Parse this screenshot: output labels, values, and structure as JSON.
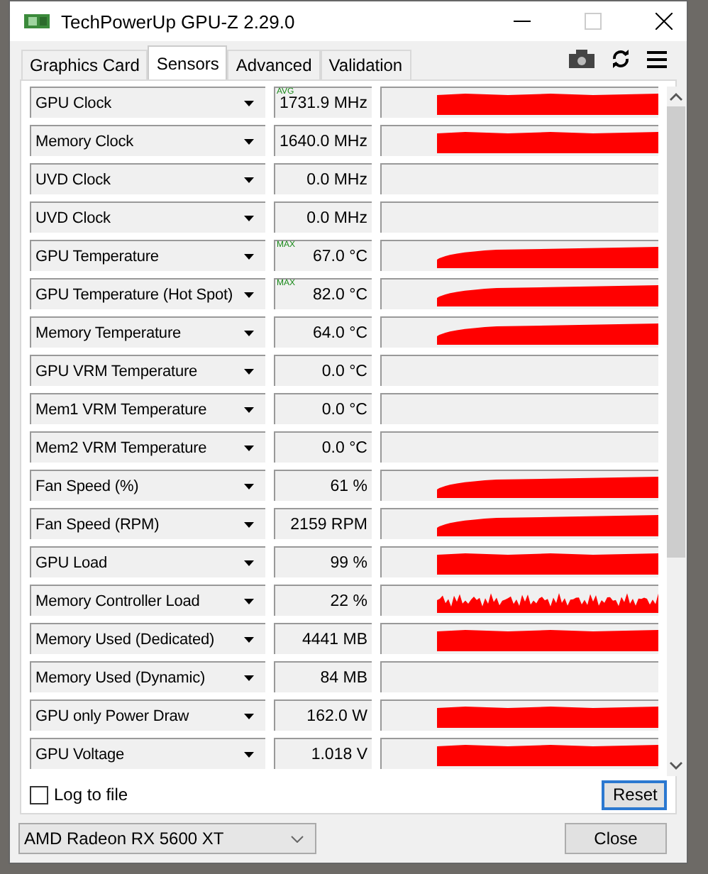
{
  "window": {
    "title": "TechPowerUp GPU-Z 2.29.0"
  },
  "tabs": [
    {
      "label": "Graphics Card",
      "selected": false
    },
    {
      "label": "Sensors",
      "selected": true
    },
    {
      "label": "Advanced",
      "selected": false
    },
    {
      "label": "Validation",
      "selected": false
    }
  ],
  "sensors": [
    {
      "name": "GPU Clock",
      "badge": "AVG",
      "value": "1731.9 MHz",
      "kind": "flat"
    },
    {
      "name": "Memory Clock",
      "value": "1640.0 MHz",
      "kind": "flat"
    },
    {
      "name": "UVD Clock",
      "value": "0.0 MHz",
      "kind": "idle"
    },
    {
      "name": "UVD Clock",
      "value": "0.0 MHz",
      "kind": "idle"
    },
    {
      "name": "GPU Temperature",
      "badge": "MAX",
      "value": "67.0 °C",
      "kind": "ramp"
    },
    {
      "name": "GPU Temperature (Hot Spot)",
      "badge": "MAX",
      "value": "82.0 °C",
      "kind": "ramp"
    },
    {
      "name": "Memory Temperature",
      "value": "64.0 °C",
      "kind": "ramp"
    },
    {
      "name": "GPU VRM Temperature",
      "value": "0.0 °C",
      "kind": "idle"
    },
    {
      "name": "Mem1 VRM Temperature",
      "value": "0.0 °C",
      "kind": "idle"
    },
    {
      "name": "Mem2 VRM Temperature",
      "value": "0.0 °C",
      "kind": "idle"
    },
    {
      "name": "Fan Speed (%)",
      "value": "61 %",
      "kind": "ramp"
    },
    {
      "name": "Fan Speed (RPM)",
      "value": "2159 RPM",
      "kind": "ramp"
    },
    {
      "name": "GPU Load",
      "value": "99 %",
      "kind": "flat"
    },
    {
      "name": "Memory Controller Load",
      "value": "22 %",
      "kind": "noisy"
    },
    {
      "name": "Memory Used (Dedicated)",
      "value": "4441 MB",
      "kind": "flat"
    },
    {
      "name": "Memory Used (Dynamic)",
      "value": "84 MB",
      "kind": "idle"
    },
    {
      "name": "GPU only Power Draw",
      "value": "162.0 W",
      "kind": "flat"
    },
    {
      "name": "GPU Voltage",
      "value": "1.018 V",
      "kind": "flat"
    }
  ],
  "log_to_file": {
    "label": "Log to file",
    "checked": false
  },
  "reset_button": "Reset",
  "gpu_select": {
    "value": "AMD Radeon RX 5600 XT"
  },
  "close_button": "Close"
}
